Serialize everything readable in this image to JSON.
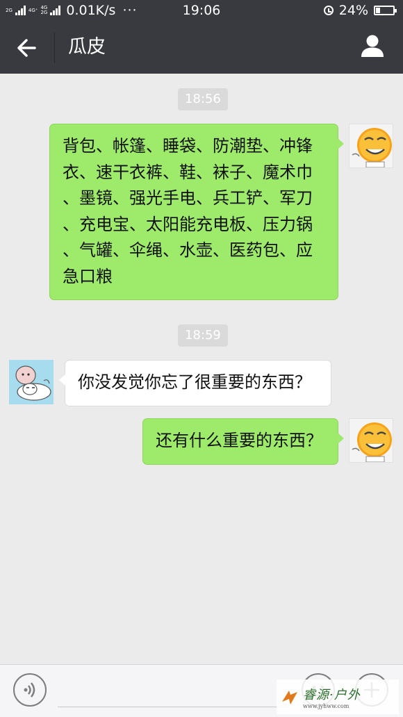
{
  "status_bar": {
    "net1": "2G",
    "net2": "4G⁺",
    "net3": "4G",
    "net4": "2G",
    "speed": "0.01K/s",
    "dots": "···",
    "time": "19:06",
    "battery_text": "24%",
    "battery_level": 0.24
  },
  "header": {
    "title": "瓜皮",
    "back_icon": "arrow-left-icon",
    "profile_icon": "person-icon"
  },
  "chat": {
    "timestamps": [
      "18:56",
      "18:59"
    ],
    "messages": [
      {
        "side": "sent",
        "lines": [
          "背包、帐篷、睡袋、防潮垫、冲锋",
          "衣、速干衣裤、鞋、袜子、魔术巾",
          "、墨镜、强光手电、兵工铲、军刀",
          "、充电宝、太阳能充电板、压力锅",
          "、气罐、伞绳、水壶、医药包、应",
          "急口粮"
        ]
      },
      {
        "side": "received",
        "lines": [
          "你没发觉你忘了很重要的东西？"
        ]
      },
      {
        "side": "sent",
        "lines": [
          "还有什么重要的东西？"
        ]
      }
    ]
  },
  "input_bar": {
    "voice_icon": "voice-icon",
    "emoji_icon": "emoji-icon",
    "plus_icon": "plus-icon"
  },
  "watermark": {
    "text": "睿源·户外",
    "url": "www.jyhww.com"
  },
  "colors": {
    "header_bg": "#393a3f",
    "chat_bg": "#ebebeb",
    "sent_bubble": "#9eea6a",
    "received_bubble": "#ffffff"
  }
}
